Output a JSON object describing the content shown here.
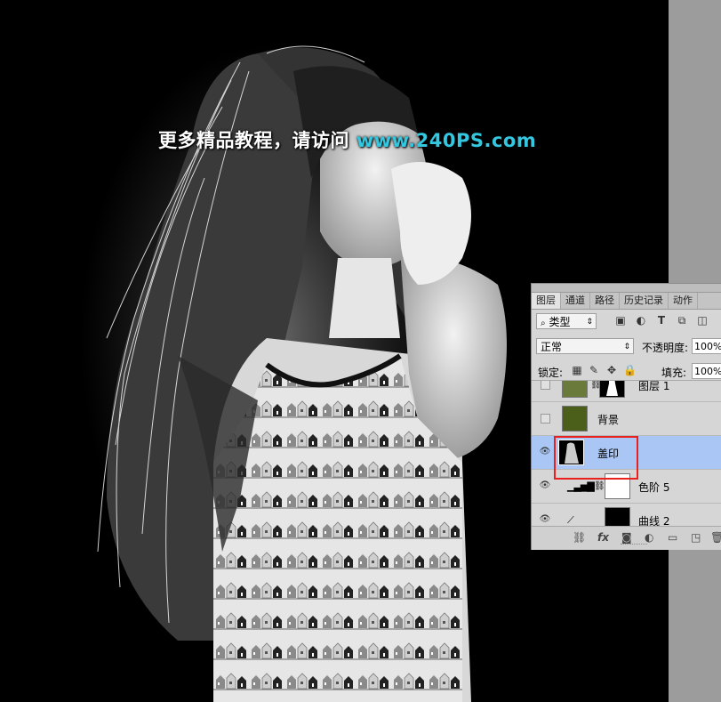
{
  "watermark": {
    "text_cn": "更多精品教程，请访问",
    "text_url": "www.240PS.com"
  },
  "panel": {
    "tabs": [
      {
        "label": "图层",
        "active": true
      },
      {
        "label": "通道"
      },
      {
        "label": "路径"
      },
      {
        "label": "历史记录"
      },
      {
        "label": "动作"
      }
    ],
    "filter": {
      "kind": "类型",
      "icons": [
        "image-filter-icon",
        "adjustment-filter-icon",
        "type-filter-icon",
        "shape-filter-icon",
        "smart-object-filter-icon"
      ]
    },
    "blend_mode": "正常",
    "opacity_label": "不透明度:",
    "opacity_value": "100%",
    "lock_label": "锁定:",
    "fill_label": "填充:",
    "fill_value": "100%",
    "layers": [
      {
        "name": "图层 1",
        "visible": false
      },
      {
        "name": "背景",
        "visible": false,
        "color": "#4b5e1a"
      },
      {
        "name": "盖印",
        "visible": true,
        "selected": true
      },
      {
        "name": "色阶 5",
        "visible": true
      },
      {
        "name": "曲线 2",
        "visible": true
      }
    ]
  },
  "colors": {
    "highlight": "#e8211d",
    "selected_layer": "#a9c6f4",
    "watermark_url": "#33c7e0"
  }
}
